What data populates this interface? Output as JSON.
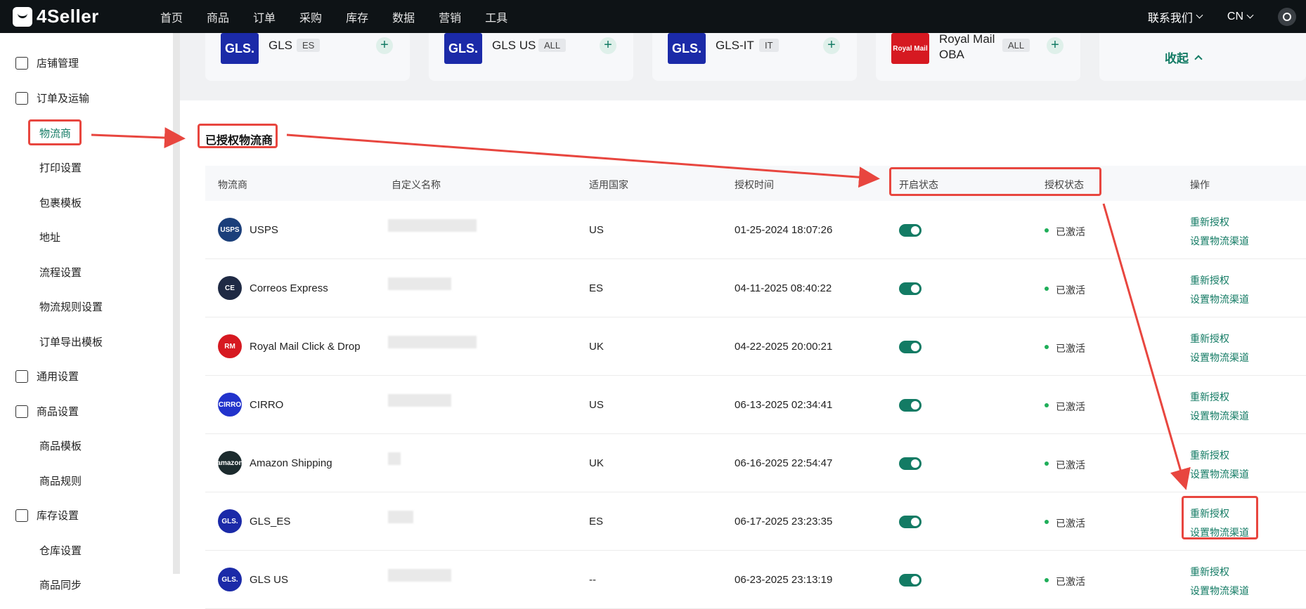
{
  "topbar": {
    "logo": "4Seller",
    "nav": [
      "首页",
      "商品",
      "订单",
      "采购",
      "库存",
      "数据",
      "营销",
      "工具"
    ],
    "contact": "联系我们",
    "lang": "CN"
  },
  "sidebar": {
    "groups": [
      {
        "label": "店铺管理",
        "icon": "store-icon"
      },
      {
        "label": "订单及运输",
        "icon": "order-icon"
      },
      {
        "label": "通用设置",
        "icon": "settings-icon"
      },
      {
        "label": "商品设置",
        "icon": "product-icon"
      },
      {
        "label": "库存设置",
        "icon": "inventory-icon"
      }
    ],
    "subs": [
      "物流商",
      "打印设置",
      "包裹模板",
      "地址",
      "流程设置",
      "物流规则设置",
      "订单导出模板",
      "商品模板",
      "商品规则",
      "仓库设置",
      "商品同步"
    ]
  },
  "carriers_cards": [
    {
      "logo": "GLS.",
      "name": "GLS",
      "tag": "ES"
    },
    {
      "logo": "GLS.",
      "name": "GLS US",
      "tag": "ALL"
    },
    {
      "logo": "GLS.",
      "name": "GLS-IT",
      "tag": "IT"
    },
    {
      "logo": "Royal Mail",
      "name": "Royal Mail OBA",
      "tag": "ALL"
    }
  ],
  "collapse_label": "收起",
  "section_title": "已授权物流商",
  "table": {
    "headers": [
      "物流商",
      "自定义名称",
      "适用国家",
      "授权时间",
      "开启状态",
      "授权状态",
      "操作"
    ],
    "rows": [
      {
        "carrier": "USPS",
        "country": "US",
        "time": "01-25-2024 18:07:26",
        "status": "已激活",
        "avatar_color": "#1b3f7a",
        "avatar_text": "USPS"
      },
      {
        "carrier": "Correos Express",
        "country": "ES",
        "time": "04-11-2025 08:40:22",
        "status": "已激活",
        "avatar_color": "#1f2a44",
        "avatar_text": "CE"
      },
      {
        "carrier": "Royal Mail Click & Drop",
        "country": "UK",
        "time": "04-22-2025 20:00:21",
        "status": "已激活",
        "avatar_color": "#d61921",
        "avatar_text": "RM"
      },
      {
        "carrier": "CIRRO",
        "country": "US",
        "time": "06-13-2025 02:34:41",
        "status": "已激活",
        "avatar_color": "#2233cc",
        "avatar_text": "CIRRO"
      },
      {
        "carrier": "Amazon Shipping",
        "country": "UK",
        "time": "06-16-2025 22:54:47",
        "status": "已激活",
        "avatar_color": "#1c2b2e",
        "avatar_text": "amazon"
      },
      {
        "carrier": "GLS_ES",
        "country": "ES",
        "time": "06-17-2025 23:23:35",
        "status": "已激活",
        "avatar_color": "#1b2aa8",
        "avatar_text": "GLS."
      },
      {
        "carrier": "GLS US",
        "country": "--",
        "time": "06-23-2025 23:13:19",
        "status": "已激活",
        "avatar_color": "#1b2aa8",
        "avatar_text": "GLS."
      }
    ],
    "op_reauth": "重新授权",
    "op_channel": "设置物流渠道"
  }
}
